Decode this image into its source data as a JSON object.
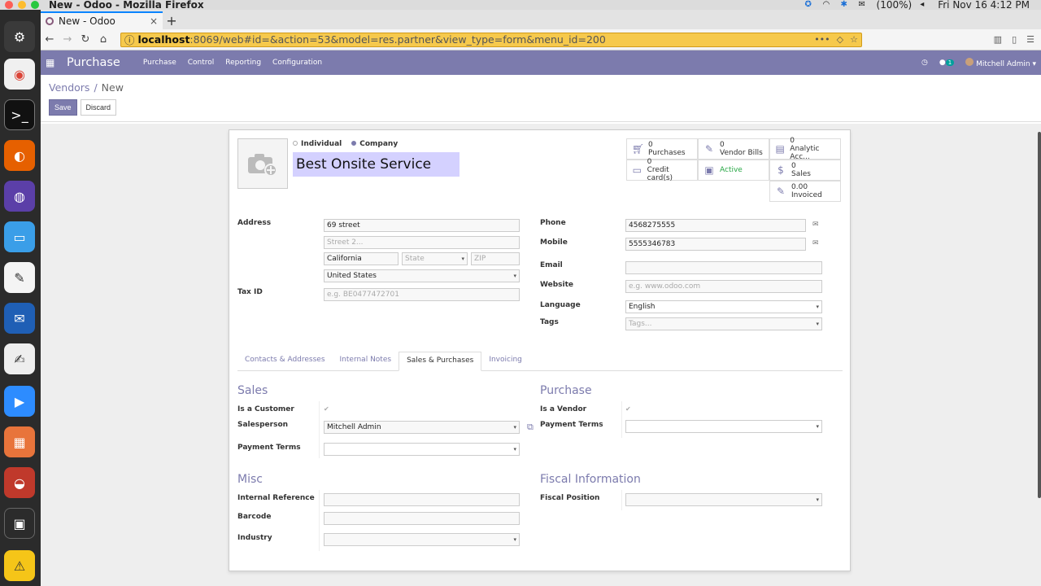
{
  "os": {
    "window_title": "New - Odoo - Mozilla Firefox",
    "battery": "(100%)",
    "clock": "Fri Nov 16  4:12 PM"
  },
  "browser": {
    "tab_title": "New - Odoo",
    "url_host": "localhost",
    "url_rest": ":8069/web#id=&action=53&model=res.partner&view_type=form&menu_id=200"
  },
  "odoo": {
    "app_name": "Purchase",
    "menu": [
      "Purchase",
      "Control",
      "Reporting",
      "Configuration"
    ],
    "chat_count": "1",
    "user": "Mitchell Admin",
    "accent": "#7c7bad"
  },
  "breadcrumb": {
    "parent": "Vendors",
    "current": "New"
  },
  "buttons": {
    "save": "Save",
    "discard": "Discard"
  },
  "partner": {
    "type_individual": "Individual",
    "type_company": "Company",
    "name": "Best Onsite Service"
  },
  "smart_buttons": [
    {
      "icon": "cart-icon",
      "value": "0",
      "label": "Purchases"
    },
    {
      "icon": "edit-icon",
      "value": "0",
      "label": "Vendor Bills"
    },
    {
      "icon": "book-icon",
      "value": "0",
      "label": "Analytic Acc..."
    },
    {
      "icon": "credit-card-icon",
      "value": "0",
      "label": "Credit card(s)"
    },
    {
      "icon": "archive-icon",
      "value": "",
      "label": "Active"
    },
    {
      "icon": "dollar-icon",
      "value": "0",
      "label": "Sales"
    },
    {
      "icon": "edit-icon",
      "value": "0.00",
      "label": "Invoiced"
    }
  ],
  "labels": {
    "address": "Address",
    "tax_id": "Tax ID",
    "phone": "Phone",
    "mobile": "Mobile",
    "email": "Email",
    "website": "Website",
    "language": "Language",
    "tags": "Tags"
  },
  "address": {
    "street": "69 street",
    "street2_ph": "Street 2...",
    "city": "California",
    "state_ph": "State",
    "zip_ph": "ZIP",
    "country": "United States",
    "tax_ph": "e.g. BE0477472701"
  },
  "contact": {
    "phone": "4568275555",
    "mobile": "5555346783",
    "email": "",
    "website_ph": "e.g. www.odoo.com",
    "language": "English",
    "tags_ph": "Tags..."
  },
  "tabs": [
    "Contacts & Addresses",
    "Internal Notes",
    "Sales & Purchases",
    "Invoicing"
  ],
  "sales": {
    "title": "Sales",
    "is_customer": "Is a Customer",
    "salesperson": "Salesperson",
    "salesperson_value": "Mitchell Admin",
    "payment_terms": "Payment Terms"
  },
  "purchase": {
    "title": "Purchase",
    "is_vendor": "Is a Vendor",
    "payment_terms": "Payment Terms"
  },
  "misc": {
    "title": "Misc",
    "internal_ref": "Internal Reference",
    "barcode": "Barcode",
    "industry": "Industry"
  },
  "fiscal": {
    "title": "Fiscal Information",
    "position": "Fiscal Position"
  }
}
